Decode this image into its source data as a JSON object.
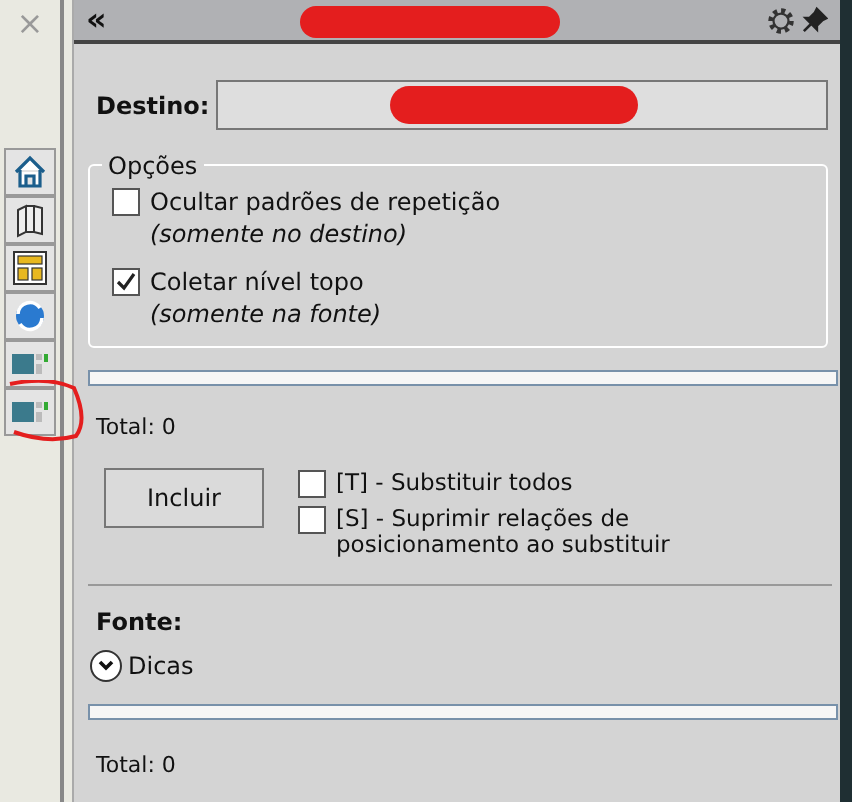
{
  "sidebar": {
    "close": "×"
  },
  "header": {
    "collapse": "«"
  },
  "destino": {
    "label": "Destino:"
  },
  "options": {
    "title": "Opções",
    "items": [
      {
        "label": "Ocultar padrões de repetição",
        "note": "(somente no destino)",
        "checked": false
      },
      {
        "label": "Coletar nível topo",
        "note": "(somente na fonte)",
        "checked": true
      }
    ]
  },
  "total_destino": "Total: 0",
  "include_button": "Incluir",
  "replace_options": [
    {
      "label": "[T] - Substituir todos",
      "checked": false
    },
    {
      "label": "[S] - Suprimir relações de posicionamento ao substituir",
      "checked": false
    }
  ],
  "fonte": {
    "label": "Fonte:",
    "hints": {
      "label": "Dicas",
      "expanded": false
    },
    "total": "Total: 0"
  }
}
